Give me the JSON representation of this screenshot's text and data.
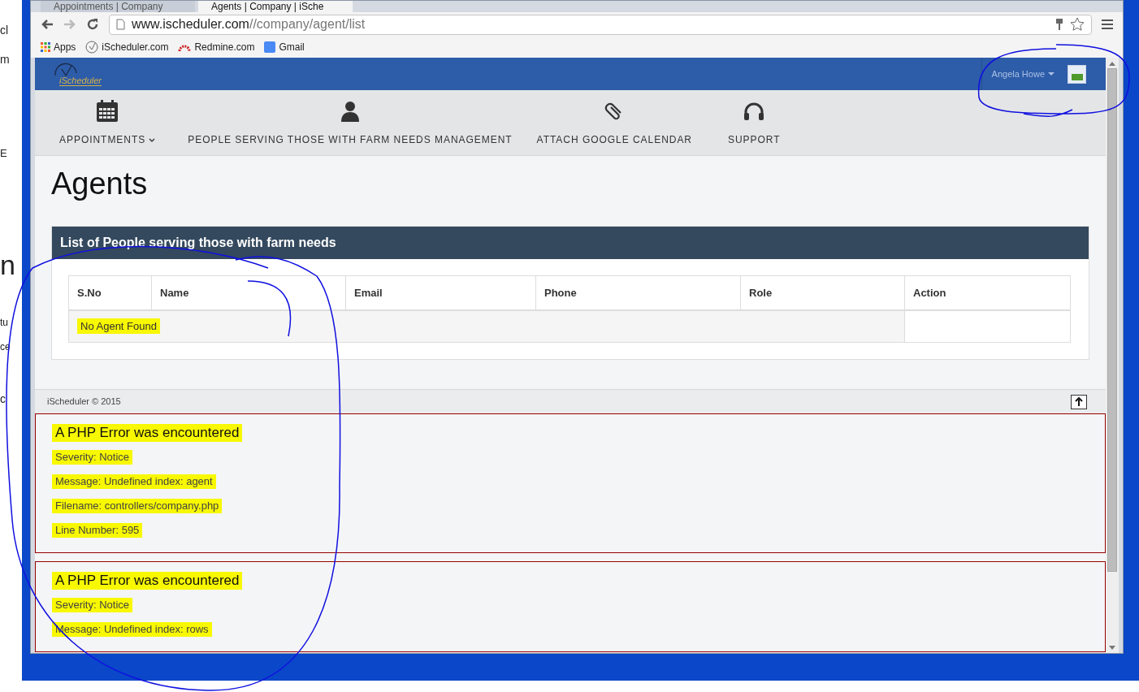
{
  "background_window": {
    "fragments": [
      "cl",
      "m",
      "E",
      "n",
      "tu",
      "ce",
      "c"
    ]
  },
  "browser": {
    "tabs": [
      {
        "title": "Appointments | Company",
        "selected": false
      },
      {
        "title": "Agents | Company | iSche",
        "selected": true
      }
    ],
    "url_host": "www.ischeduler.com",
    "url_path": "//company/agent/list",
    "bookmarks": [
      {
        "label": "Apps",
        "kind": "apps"
      },
      {
        "label": "iScheduler.com",
        "kind": "clock"
      },
      {
        "label": "Redmine.com",
        "kind": "redmine"
      },
      {
        "label": "Gmail",
        "kind": "google"
      }
    ]
  },
  "header": {
    "logo": "iScheduler",
    "user": "Angela Howe"
  },
  "nav": [
    {
      "label": "APPOINTMENTS",
      "kind": "calendar",
      "dropdown": true
    },
    {
      "label": "PEOPLE SERVING THOSE WITH FARM NEEDS MANAGEMENT",
      "kind": "person",
      "dropdown": false
    },
    {
      "label": "ATTACH GOOGLE CALENDAR",
      "kind": "paperclip",
      "dropdown": false
    },
    {
      "label": "SUPPORT",
      "kind": "headset",
      "dropdown": false
    }
  ],
  "page_title": "Agents",
  "panel": {
    "title": "List of People serving those with farm needs",
    "columns": [
      "S.No",
      "Name",
      "Email",
      "Phone",
      "Role",
      "Action"
    ],
    "empty_message": {
      "text": "No Agent Found",
      "highlighted": true
    }
  },
  "footer": {
    "text": "iScheduler © 2015"
  },
  "errors": [
    {
      "heading": {
        "text": "A PHP Error was encountered",
        "highlighted": true
      },
      "lines": [
        {
          "text": "Severity: Notice",
          "highlighted": true
        },
        {
          "text": "Message: Undefined index: agent",
          "highlighted": true
        },
        {
          "text": "Filename: controllers/company.php",
          "highlighted": true
        },
        {
          "text": "Line Number: 595",
          "highlighted": true
        }
      ]
    },
    {
      "heading": {
        "text": "A PHP Error was encountered",
        "highlighted": true
      },
      "lines": [
        {
          "text": "Severity: Notice",
          "highlighted": true
        },
        {
          "text": "Message: Undefined index: rows",
          "highlighted": true
        }
      ]
    }
  ]
}
